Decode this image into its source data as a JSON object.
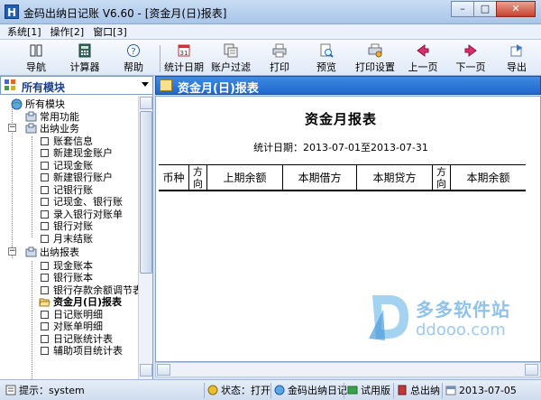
{
  "window": {
    "title": "金码出纳日记账 V6.60 - [资金月(日)报表]",
    "app_icon": "H"
  },
  "menu": [
    "系统[1]",
    "操作[2]",
    "窗口[3]"
  ],
  "toolbar": [
    {
      "label": "导航",
      "icon": "navigation-icon"
    },
    {
      "label": "计算器",
      "icon": "calculator-icon"
    },
    {
      "label": "帮助",
      "icon": "help-icon"
    },
    {
      "label": "统计日期",
      "icon": "calendar-icon"
    },
    {
      "label": "账户过滤",
      "icon": "filter-icon"
    },
    {
      "label": "打印",
      "icon": "print-icon"
    },
    {
      "label": "预览",
      "icon": "preview-icon"
    },
    {
      "label": "打印设置",
      "icon": "print-settings-icon"
    },
    {
      "label": "上一页",
      "icon": "prev-page-icon"
    },
    {
      "label": "下一页",
      "icon": "next-page-icon"
    },
    {
      "label": "导出",
      "icon": "export-icon"
    }
  ],
  "module_select": {
    "value": "所有模块"
  },
  "tree": {
    "root": "所有模块",
    "common": "常用功能",
    "business": {
      "label": "出纳业务",
      "items": [
        "账套信息",
        "新建现金账户",
        "记现金账",
        "新建银行账户",
        "记银行账",
        "记现金、银行账",
        "录入银行对账单",
        "银行对账",
        "月末结账"
      ]
    },
    "reports": {
      "label": "出纳报表",
      "items": [
        "现金账本",
        "银行账本",
        "银行存款余额调节表",
        "资金月(日)报表",
        "日记账明细",
        "对账单明细",
        "日记账统计表",
        "辅助项目统计表"
      ],
      "selected": "资金月(日)报表"
    }
  },
  "report": {
    "header": "资金月(日)报表",
    "title": "资金月报表",
    "date_range": "统计日期：2013-07-01至2013-07-31",
    "columns": [
      "币种",
      "方向",
      "上期余额",
      "本期借方",
      "本期贷方",
      "方向",
      "本期余额"
    ]
  },
  "watermark": {
    "line1": "多多软件站",
    "line2": "ddooo.com"
  },
  "status": {
    "hint": "提示：system",
    "state": "状态：打开",
    "app": "金码出纳日记",
    "edition": "试用版",
    "book": "总出纳",
    "date": "2013-07-05"
  }
}
